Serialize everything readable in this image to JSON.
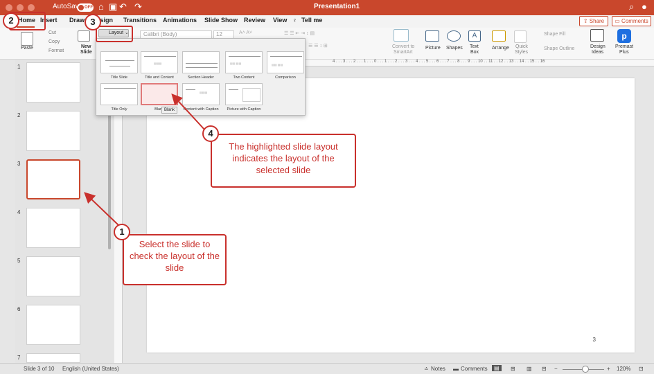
{
  "titlebar": {
    "autosave": "AutoSave",
    "autosave_state": "OFF",
    "doc_title": "Presentation1"
  },
  "tabs": [
    "Home",
    "Insert",
    "Draw",
    "Design",
    "Transitions",
    "Animations",
    "Slide Show",
    "Review",
    "View"
  ],
  "tell_me": "Tell me",
  "share": "Share",
  "comments": "Comments",
  "ribbon": {
    "paste": "Paste",
    "cut": "Cut",
    "copy": "Copy",
    "format": "Format",
    "new_slide_1": "New",
    "new_slide_2": "Slide",
    "layout": "Layout",
    "font": "Calibri (Body)",
    "font_size": "12",
    "convert_1": "Convert to",
    "convert_2": "SmartArt",
    "picture": "Picture",
    "shapes": "Shapes",
    "text_1": "Text",
    "text_2": "Box",
    "arrange": "Arrange",
    "quick_1": "Quick",
    "quick_2": "Styles",
    "shape_fill": "Shape Fill",
    "shape_outline": "Shape Outline",
    "design_1": "Design",
    "design_2": "Ideas",
    "premast_1": "Premast",
    "premast_2": "Plus"
  },
  "layouts": [
    {
      "label": "Title Slide"
    },
    {
      "label": "Title and Content"
    },
    {
      "label": "Section Header"
    },
    {
      "label": "Two Content"
    },
    {
      "label": "Comparison"
    },
    {
      "label": "Title Only"
    },
    {
      "label": "Blank"
    },
    {
      "label": "Content with Caption"
    },
    {
      "label": "Picture with Caption"
    }
  ],
  "tooltip": "Blank",
  "thumb_numbers": [
    "1",
    "2",
    "3",
    "4",
    "5",
    "6",
    "7"
  ],
  "slide_number": "3",
  "status": {
    "slide": "Slide 3 of 10",
    "language": "English (United States)",
    "notes": "Notes",
    "comments": "Comments",
    "zoom": "120%"
  },
  "annotations": {
    "step1": "1",
    "step2": "2",
    "step3": "3",
    "step4": "4",
    "callout1": "Select the slide to check the layout of the slide",
    "callout4": "The highlighted slide layout indicates the layout of the selected slide"
  },
  "colors": {
    "titlebar": "#c9472c",
    "annotation": "#c9302c"
  }
}
